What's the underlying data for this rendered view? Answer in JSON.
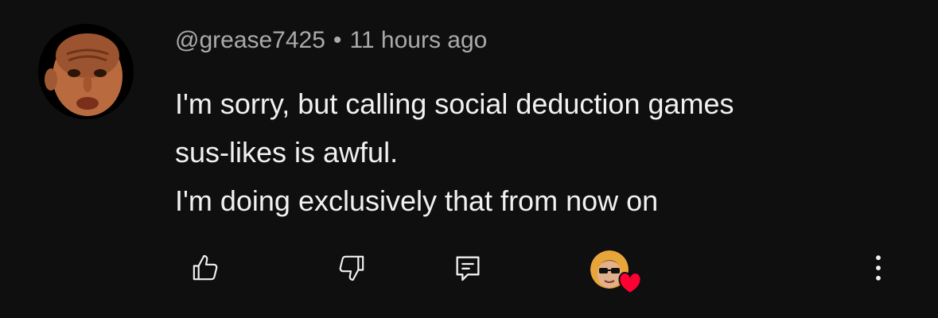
{
  "comment": {
    "author": "@grease7425",
    "separator": "•",
    "timestamp": "11 hours ago",
    "lines": [
      "I'm sorry, but calling social deduction games",
      "sus-likes is awful.",
      "I'm doing exclusively that from now on"
    ]
  },
  "actions": {
    "like_icon": "thumbs-up-icon",
    "dislike_icon": "thumbs-down-icon",
    "reply_icon": "reply-comment-icon",
    "creator_heart_icon": "creator-heart-icon",
    "more_icon": "more-vertical-icon"
  },
  "colors": {
    "background": "#0f0f0f",
    "text_primary": "#f1f1f1",
    "text_secondary": "#aaaaaa",
    "heart": "#ff0033"
  }
}
